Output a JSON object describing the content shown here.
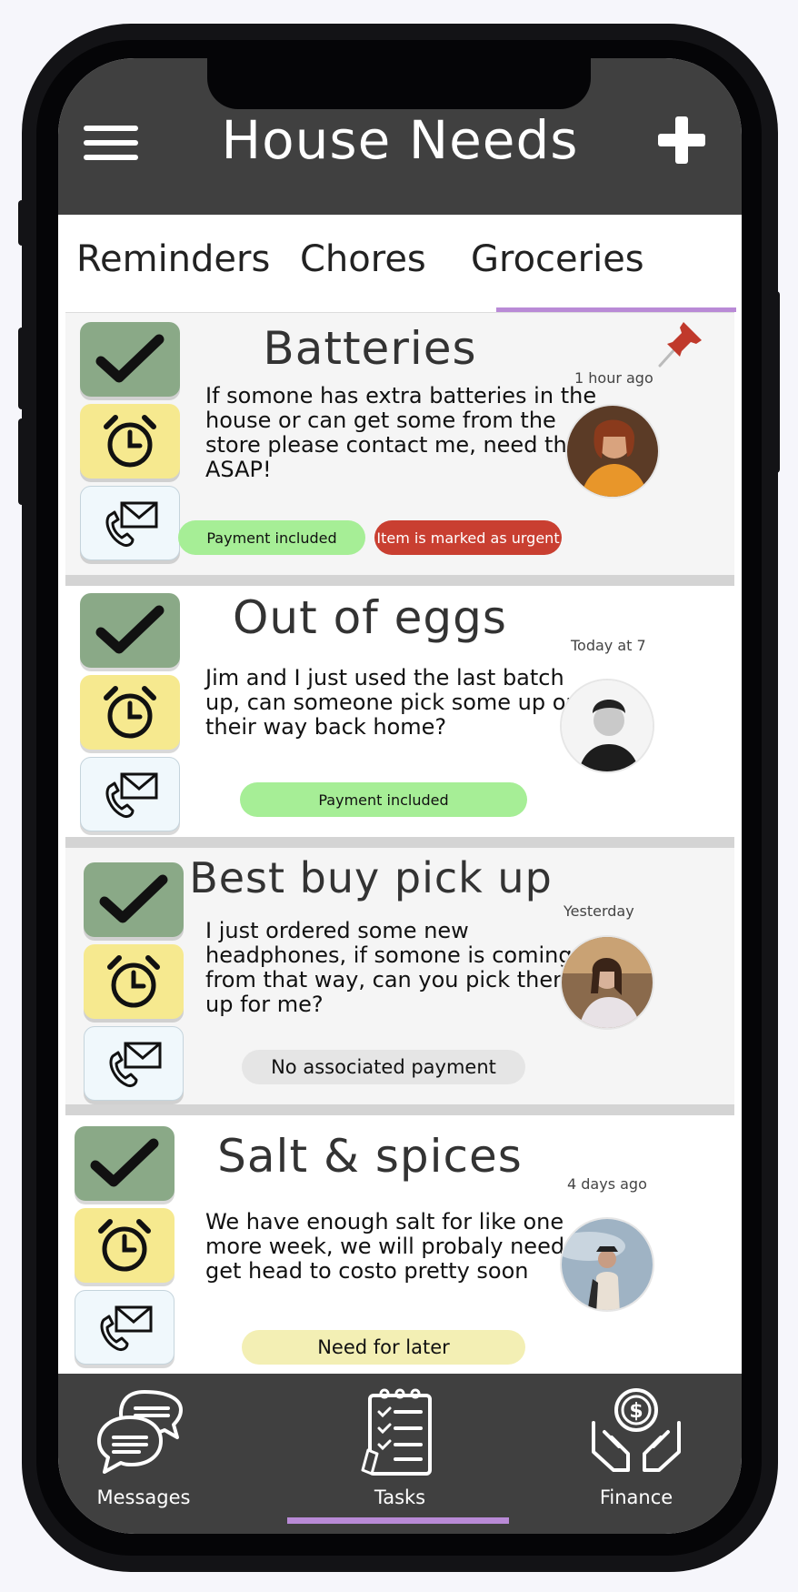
{
  "header": {
    "title": "House Needs"
  },
  "tabs": [
    {
      "label": "Reminders"
    },
    {
      "label": "Chores"
    },
    {
      "label": "Groceries"
    }
  ],
  "active_tab": "Groceries",
  "cards": [
    {
      "title": "Batteries",
      "body": "If somone has extra batteries in the house or can get some from the store please contact me, need them ASAP!",
      "time": "1 hour ago",
      "pinned": true,
      "tags": [
        {
          "label": "Payment included",
          "color": "#a6ee96"
        },
        {
          "label": "Item is marked as urgent",
          "color": "#c93f31"
        }
      ]
    },
    {
      "title": "Out of eggs",
      "body": "Jim and I just used the last batch up, can someone pick some up on their way back home?",
      "time": "Today at 7",
      "tags": [
        {
          "label": "Payment included",
          "color": "#a6ee96"
        }
      ]
    },
    {
      "title": "Best buy pick up",
      "body": "I just ordered some new headphones, if somone is coming from that way, can you pick them up for me?",
      "time": "Yesterday",
      "tags": [
        {
          "label": "No associated payment",
          "color": "#e5e5e5"
        }
      ]
    },
    {
      "title": "Salt & spices",
      "body": "We have enough salt for like one more week, we will probaly need to get head to costo pretty soon",
      "time": "4 days ago",
      "tags": [
        {
          "label": "Need for later",
          "color": "#f3efb4"
        }
      ]
    }
  ],
  "nav": [
    {
      "label": "Messages",
      "icon": "chat-bubbles-icon"
    },
    {
      "label": "Tasks",
      "icon": "clipboard-checklist-icon"
    },
    {
      "label": "Finance",
      "icon": "hands-coin-icon"
    }
  ],
  "active_nav": "Tasks",
  "colors": {
    "header_bg": "#404040",
    "accent": "#b98ad6",
    "check": "#8aa987",
    "alarm": "#f6e98f",
    "contact": "#f0f8fc"
  }
}
